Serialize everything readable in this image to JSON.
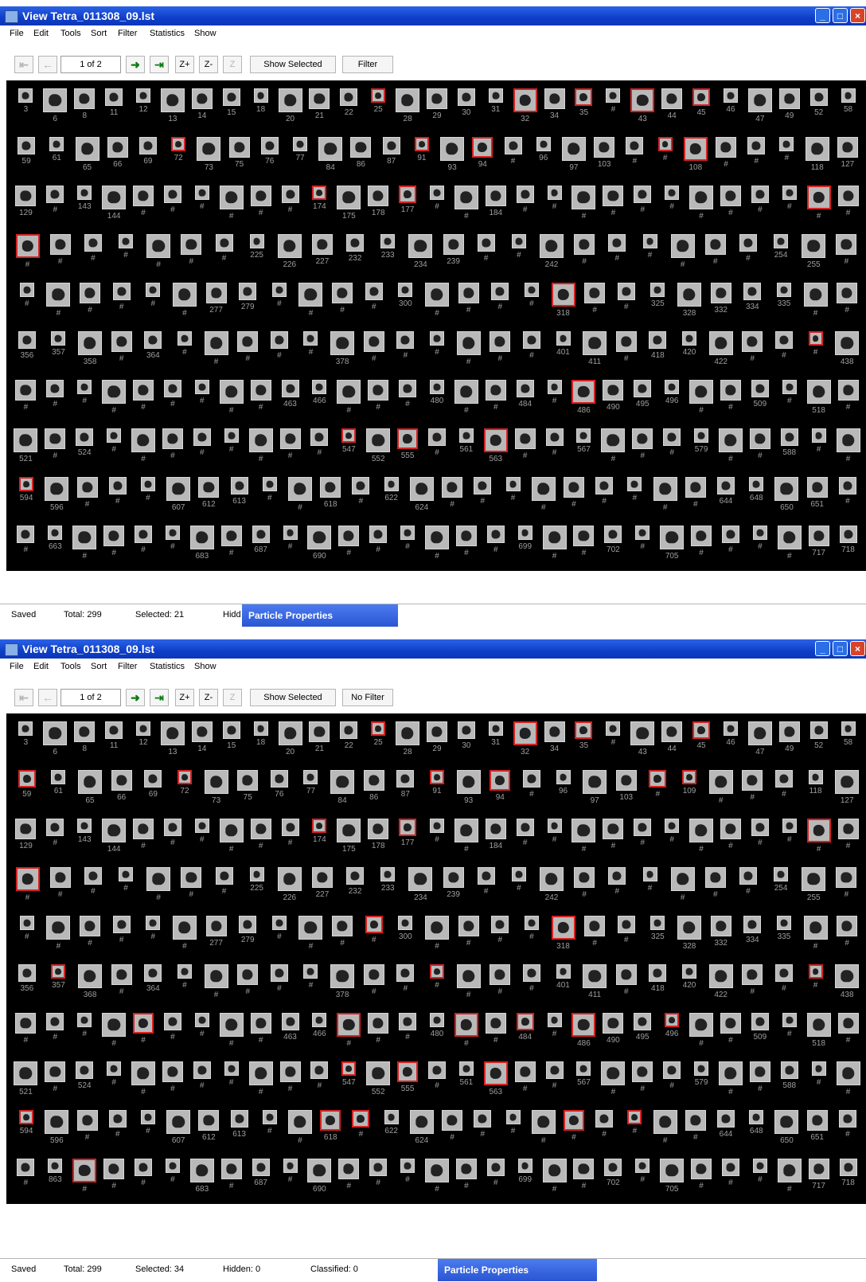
{
  "windows": [
    {
      "title": "View  Tetra_011308_09.lst",
      "menu": [
        "File",
        "Edit",
        "Tools",
        "Sort",
        "Filter",
        "Statistics",
        "Show"
      ],
      "toolbar": {
        "page_indicator": "1 of 2",
        "zoom_in": "Z+",
        "zoom_out": "Z-",
        "show_selected": "Show Selected",
        "filter": "Filter"
      },
      "status": {
        "saved": "Saved",
        "total": "Total: 299",
        "selected": "Selected: 21",
        "hidden": "Hidd",
        "classified": "",
        "panel": "Particle Properties"
      },
      "rows": [
        {
          "labels": [
            "3",
            "6",
            "8",
            "11",
            "12",
            "13",
            "14",
            "15",
            "18",
            "20",
            "21",
            "22",
            "25",
            "28",
            "29",
            "30",
            "31",
            "32",
            "34",
            "35",
            "#",
            "43",
            "44",
            "45",
            "46",
            "47",
            "49",
            "52",
            "58"
          ],
          "selected": [
            12,
            17,
            19,
            21,
            23
          ]
        },
        {
          "labels": [
            "59",
            "61",
            "65",
            "66",
            "69",
            "72",
            "73",
            "75",
            "76",
            "77",
            "84",
            "86",
            "87",
            "91",
            "93",
            "94",
            "#",
            "96",
            "97",
            "103",
            "#",
            "#",
            "108",
            "#",
            "#",
            "#",
            "118",
            "127"
          ],
          "selected": [
            5,
            13,
            15,
            21,
            22
          ]
        },
        {
          "labels": [
            "129",
            "#",
            "143",
            "144",
            "#",
            "#",
            "#",
            "#",
            "#",
            "#",
            "174",
            "175",
            "178",
            "177",
            "#",
            "#",
            "184",
            "#",
            "#",
            "#",
            "#",
            "#",
            "#",
            "#",
            "#",
            "#",
            "#",
            "#",
            "#"
          ],
          "selected": [
            10,
            13,
            27
          ]
        },
        {
          "labels": [
            "#",
            "#",
            "#",
            "#",
            "#",
            "#",
            "#",
            "225",
            "226",
            "227",
            "232",
            "233",
            "234",
            "239",
            "#",
            "#",
            "242",
            "#",
            "#",
            "#",
            "#",
            "#",
            "#",
            "254",
            "255",
            "#"
          ],
          "selected": [
            0
          ]
        },
        {
          "labels": [
            "#",
            "#",
            "#",
            "#",
            "#",
            "#",
            "277",
            "279",
            "#",
            "#",
            "#",
            "#",
            "300",
            "#",
            "#",
            "#",
            "#",
            "318",
            "#",
            "#",
            "325",
            "328",
            "332",
            "334",
            "335",
            "#",
            "#"
          ],
          "selected": [
            17
          ]
        },
        {
          "labels": [
            "356",
            "357",
            "358",
            "#",
            "364",
            "#",
            "#",
            "#",
            "#",
            "#",
            "378",
            "#",
            "#",
            "#",
            "#",
            "#",
            "#",
            "401",
            "411",
            "#",
            "418",
            "420",
            "422",
            "#",
            "#",
            "#",
            "438"
          ],
          "selected": [
            25
          ]
        },
        {
          "labels": [
            "#",
            "#",
            "#",
            "#",
            "#",
            "#",
            "#",
            "#",
            "#",
            "463",
            "466",
            "#",
            "#",
            "#",
            "480",
            "#",
            "#",
            "484",
            "#",
            "486",
            "490",
            "495",
            "496",
            "#",
            "#",
            "509",
            "#",
            "518",
            "#"
          ],
          "selected": [
            19
          ]
        },
        {
          "labels": [
            "521",
            "#",
            "524",
            "#",
            "#",
            "#",
            "#",
            "#",
            "#",
            "#",
            "#",
            "547",
            "552",
            "555",
            "#",
            "561",
            "563",
            "#",
            "#",
            "567",
            "#",
            "#",
            "#",
            "579",
            "#",
            "#",
            "588",
            "#",
            "#"
          ],
          "selected": [
            11,
            13,
            16
          ]
        },
        {
          "labels": [
            "594",
            "596",
            "#",
            "#",
            "#",
            "607",
            "612",
            "613",
            "#",
            "#",
            "618",
            "#",
            "622",
            "624",
            "#",
            "#",
            "#",
            "#",
            "#",
            "#",
            "#",
            "#",
            "#",
            "644",
            "648",
            "650",
            "651",
            "#"
          ],
          "selected": [
            0
          ]
        },
        {
          "labels": [
            "#",
            "663",
            "#",
            "#",
            "#",
            "#",
            "683",
            "#",
            "687",
            "#",
            "690",
            "#",
            "#",
            "#",
            "#",
            "#",
            "#",
            "699",
            "#",
            "#",
            "702",
            "#",
            "705",
            "#",
            "#",
            "#",
            "#",
            "717",
            "718"
          ],
          "selected": []
        }
      ]
    },
    {
      "title": "View  Tetra_011308_09.lst",
      "menu": [
        "File",
        "Edit",
        "Tools",
        "Sort",
        "Filter",
        "Statistics",
        "Show"
      ],
      "toolbar": {
        "page_indicator": "1 of 2",
        "zoom_in": "Z+",
        "zoom_out": "Z-",
        "show_selected": "Show Selected",
        "filter": "No Filter"
      },
      "status": {
        "saved": "Saved",
        "total": "Total: 299",
        "selected": "Selected: 34",
        "hidden": "Hidden: 0",
        "classified": "Classified: 0",
        "panel": "Particle Properties"
      },
      "rows": [
        {
          "labels": [
            "3",
            "6",
            "8",
            "11",
            "12",
            "13",
            "14",
            "15",
            "18",
            "20",
            "21",
            "22",
            "25",
            "28",
            "29",
            "30",
            "31",
            "32",
            "34",
            "35",
            "#",
            "43",
            "44",
            "45",
            "46",
            "47",
            "49",
            "52",
            "58"
          ],
          "selected": [
            12,
            17,
            19,
            23
          ]
        },
        {
          "labels": [
            "59",
            "61",
            "65",
            "66",
            "69",
            "72",
            "73",
            "75",
            "76",
            "77",
            "84",
            "86",
            "87",
            "91",
            "93",
            "94",
            "#",
            "96",
            "97",
            "103",
            "#",
            "109",
            "#",
            "#",
            "#",
            "118",
            "127"
          ],
          "selected": [
            0,
            5,
            13,
            15,
            20,
            21
          ]
        },
        {
          "labels": [
            "129",
            "#",
            "143",
            "144",
            "#",
            "#",
            "#",
            "#",
            "#",
            "#",
            "174",
            "175",
            "178",
            "177",
            "#",
            "#",
            "184",
            "#",
            "#",
            "#",
            "#",
            "#",
            "#",
            "#",
            "#",
            "#",
            "#",
            "#",
            "#"
          ],
          "selected": [
            10,
            13,
            27
          ]
        },
        {
          "labels": [
            "#",
            "#",
            "#",
            "#",
            "#",
            "#",
            "#",
            "225",
            "226",
            "227",
            "232",
            "233",
            "234",
            "239",
            "#",
            "#",
            "242",
            "#",
            "#",
            "#",
            "#",
            "#",
            "#",
            "254",
            "255",
            "#"
          ],
          "selected": [
            0
          ]
        },
        {
          "labels": [
            "#",
            "#",
            "#",
            "#",
            "#",
            "#",
            "277",
            "279",
            "#",
            "#",
            "#",
            "#",
            "300",
            "#",
            "#",
            "#",
            "#",
            "318",
            "#",
            "#",
            "325",
            "328",
            "332",
            "334",
            "335",
            "#",
            "#"
          ],
          "selected": [
            11,
            17
          ]
        },
        {
          "labels": [
            "356",
            "357",
            "368",
            "#",
            "364",
            "#",
            "#",
            "#",
            "#",
            "#",
            "378",
            "#",
            "#",
            "#",
            "#",
            "#",
            "#",
            "401",
            "411",
            "#",
            "418",
            "420",
            "422",
            "#",
            "#",
            "#",
            "438"
          ],
          "selected": [
            1,
            13,
            25
          ]
        },
        {
          "labels": [
            "#",
            "#",
            "#",
            "#",
            "#",
            "#",
            "#",
            "#",
            "#",
            "463",
            "466",
            "#",
            "#",
            "#",
            "480",
            "#",
            "#",
            "484",
            "#",
            "486",
            "490",
            "495",
            "496",
            "#",
            "#",
            "509",
            "#",
            "518",
            "#"
          ],
          "selected": [
            4,
            11,
            15,
            17,
            19,
            22
          ]
        },
        {
          "labels": [
            "521",
            "#",
            "524",
            "#",
            "#",
            "#",
            "#",
            "#",
            "#",
            "#",
            "#",
            "547",
            "552",
            "555",
            "#",
            "561",
            "563",
            "#",
            "#",
            "567",
            "#",
            "#",
            "#",
            "579",
            "#",
            "#",
            "588",
            "#",
            "#"
          ],
          "selected": [
            11,
            13,
            16
          ]
        },
        {
          "labels": [
            "594",
            "596",
            "#",
            "#",
            "#",
            "607",
            "612",
            "613",
            "#",
            "#",
            "618",
            "#",
            "622",
            "624",
            "#",
            "#",
            "#",
            "#",
            "#",
            "#",
            "#",
            "#",
            "#",
            "644",
            "648",
            "650",
            "651",
            "#"
          ],
          "selected": [
            0,
            10,
            11,
            18,
            20
          ]
        },
        {
          "labels": [
            "#",
            "863",
            "#",
            "#",
            "#",
            "#",
            "683",
            "#",
            "687",
            "#",
            "690",
            "#",
            "#",
            "#",
            "#",
            "#",
            "#",
            "699",
            "#",
            "#",
            "702",
            "#",
            "705",
            "#",
            "#",
            "#",
            "#",
            "717",
            "718"
          ],
          "selected": [
            2
          ]
        }
      ]
    }
  ]
}
